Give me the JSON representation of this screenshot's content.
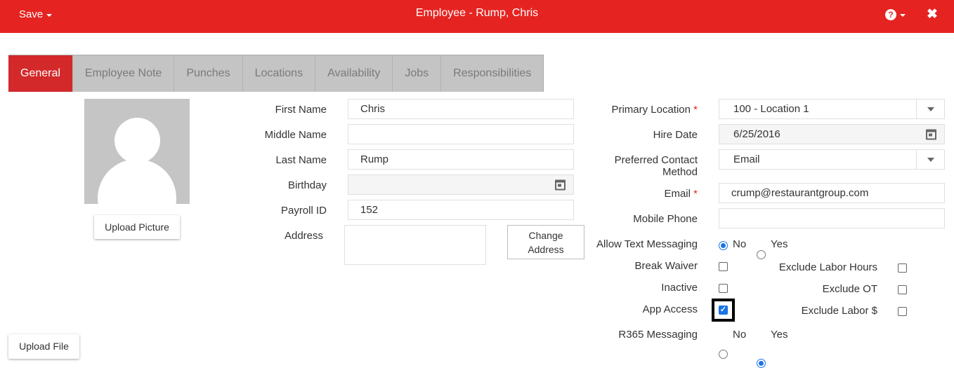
{
  "header": {
    "save_label": "Save",
    "title": "Employee - Rump, Chris",
    "help_icon": "?",
    "close_icon": "✖",
    "color": "#e52421"
  },
  "tabs": [
    {
      "label": "General",
      "active": true
    },
    {
      "label": "Employee Note"
    },
    {
      "label": "Punches"
    },
    {
      "label": "Locations"
    },
    {
      "label": "Availability"
    },
    {
      "label": "Jobs"
    },
    {
      "label": "Responsibilities"
    }
  ],
  "photo": {
    "upload_label": "Upload Picture"
  },
  "upload_file_label": "Upload File",
  "form": {
    "first_name": {
      "label": "First Name",
      "value": "Chris"
    },
    "middle_name": {
      "label": "Middle Name",
      "value": ""
    },
    "last_name": {
      "label": "Last Name",
      "value": "Rump"
    },
    "birthday": {
      "label": "Birthday",
      "value": ""
    },
    "payroll_id": {
      "label": "Payroll ID",
      "value": "152"
    },
    "address": {
      "label": "Address",
      "value": "",
      "change_line1": "Change",
      "change_line2": "Address"
    },
    "primary_location": {
      "label": "Primary Location",
      "required": "*",
      "value": "100 - Location 1"
    },
    "hire_date": {
      "label": "Hire Date",
      "value": "6/25/2016"
    },
    "preferred_contact": {
      "label_line1": "Preferred Contact",
      "label_line2": "Method",
      "value": "Email"
    },
    "email": {
      "label": "Email",
      "required": "*",
      "value": "crump@restaurantgroup.com"
    },
    "mobile_phone": {
      "label": "Mobile Phone",
      "value": ""
    },
    "allow_text": {
      "label": "Allow Text Messaging",
      "no": "No",
      "yes": "Yes",
      "selected": "No"
    },
    "break_waiver": {
      "label": "Break Waiver",
      "checked": false
    },
    "inactive": {
      "label": "Inactive",
      "checked": false
    },
    "app_access": {
      "label": "App Access",
      "checked": true
    },
    "exclude_labor_hours": {
      "label": "Exclude Labor Hours",
      "checked": false
    },
    "exclude_ot": {
      "label": "Exclude OT",
      "checked": false
    },
    "exclude_labor_dollars": {
      "label": "Exclude Labor $",
      "checked": false
    },
    "r365_messaging": {
      "label": "R365 Messaging",
      "no": "No",
      "yes": "Yes",
      "selected": "Yes"
    }
  }
}
